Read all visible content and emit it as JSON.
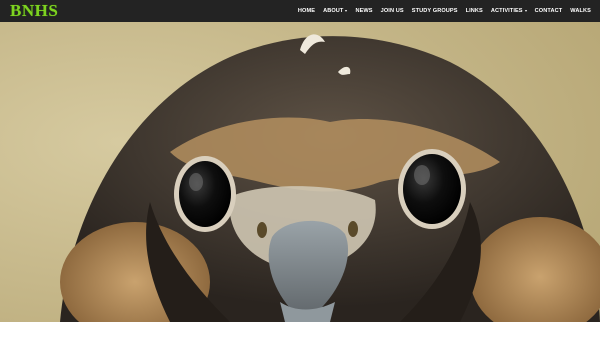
{
  "brand": {
    "logo_text": "BNHS"
  },
  "nav": {
    "items": [
      {
        "label": "HOME",
        "dropdown": false
      },
      {
        "label": "ABOUT",
        "dropdown": true
      },
      {
        "label": "NEWS",
        "dropdown": false
      },
      {
        "label": "JOIN US",
        "dropdown": false
      },
      {
        "label": "STUDY GROUPS",
        "dropdown": false
      },
      {
        "label": "LINKS",
        "dropdown": false
      },
      {
        "label": "ACTIVITIES",
        "dropdown": true
      },
      {
        "label": "CONTACT",
        "dropdown": false
      },
      {
        "label": "WALKS",
        "dropdown": false
      }
    ]
  },
  "hero": {
    "image_subject": "falcon-face-photo"
  },
  "colors": {
    "header_bg": "#232323",
    "logo": "#7ed321",
    "nav_text": "#ffffff"
  }
}
